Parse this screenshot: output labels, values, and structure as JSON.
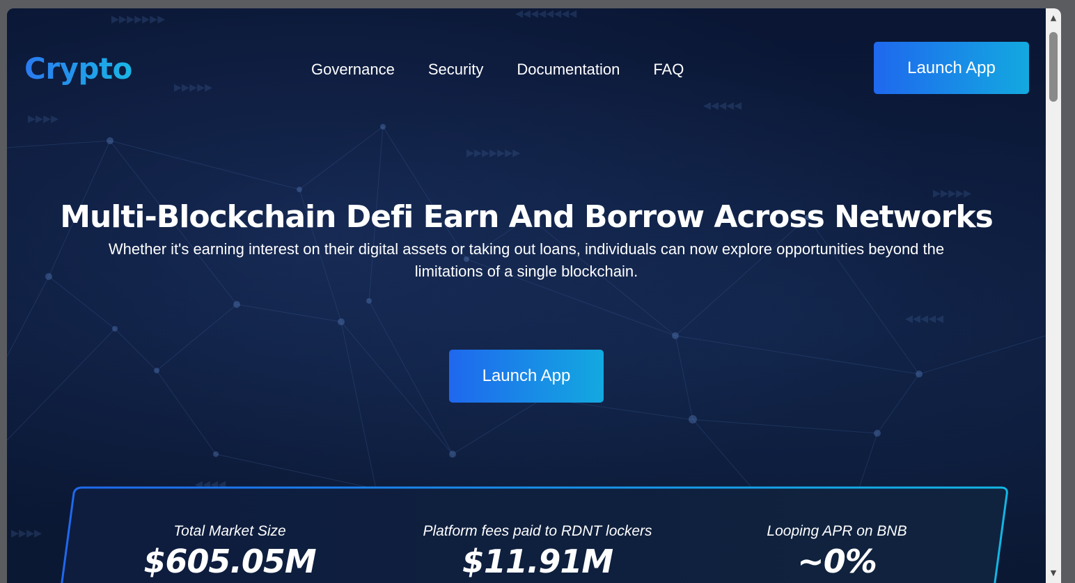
{
  "header": {
    "logo": "Crypto",
    "nav": [
      "Governance",
      "Security",
      "Documentation",
      "FAQ"
    ],
    "cta_label": "Launch App"
  },
  "hero": {
    "title": "Multi-Blockchain Defi Earn And Borrow Across Networks",
    "subtitle": "Whether it's earning interest on their digital assets or taking out loans, individuals can now explore opportunities beyond the limitations of a single blockchain.",
    "cta_label": "Launch App"
  },
  "stats": [
    {
      "label": "Total Market Size",
      "value": "$605.05M"
    },
    {
      "label": "Platform fees paid to RDNT lockers",
      "value": "$11.91M"
    },
    {
      "label": "Looping APR on BNB",
      "value": "~0%"
    }
  ],
  "colors": {
    "background": "#0b1736",
    "accent_start": "#1f68ee",
    "accent_end": "#13a9e0",
    "text": "#ffffff"
  }
}
